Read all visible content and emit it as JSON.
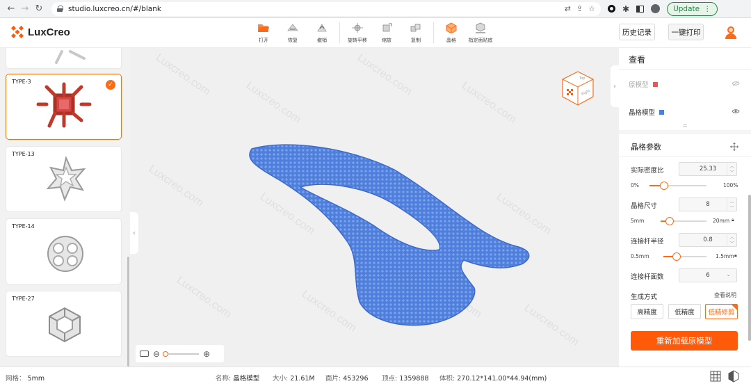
{
  "browser": {
    "url": "studio.luxcreo.cn/#/blank",
    "update_label": "Update"
  },
  "app": {
    "brand": "LuxCreo",
    "accent": "#ff6a14",
    "toolbar": [
      {
        "label": "打开",
        "icon": "open-folder-icon"
      },
      {
        "label": "恢复",
        "icon": "redo-icon"
      },
      {
        "label": "撤销",
        "icon": "undo-icon"
      },
      {
        "label": "旋转平移",
        "icon": "rotate-move-icon"
      },
      {
        "label": "缩放",
        "icon": "scale-icon"
      },
      {
        "label": "复制",
        "icon": "copy-icon"
      },
      {
        "label": "晶格",
        "icon": "lattice-icon"
      },
      {
        "label": "指定面贴底",
        "icon": "face-to-bottom-icon"
      }
    ],
    "history_label": "历史记录",
    "print_label": "一键打印"
  },
  "sidebar": {
    "items": [
      {
        "label": "TYPE-3",
        "selected": true
      },
      {
        "label": "TYPE-13",
        "selected": false
      },
      {
        "label": "TYPE-14",
        "selected": false
      },
      {
        "label": "TYPE-27",
        "selected": false
      }
    ]
  },
  "viewport": {
    "watermark": "Luxcreo.com",
    "cube_faces": [
      "Top",
      "Right"
    ],
    "model_color": "#4f7fdc"
  },
  "panel": {
    "view_title": "查看",
    "original_model": {
      "label": "原模型",
      "color": "#e05a5a"
    },
    "lattice_model": {
      "label": "晶格模型",
      "color": "#4f7fdc"
    },
    "params_title": "晶格参数",
    "density": {
      "label": "实际密度比",
      "value": "25.33",
      "min": "0%",
      "max": "100%",
      "fraction": 0.2533
    },
    "cell_size": {
      "label": "晶格尺寸",
      "value": "8",
      "min": "5mm",
      "max": "20mm",
      "fraction": 0.2
    },
    "rod_radius": {
      "label": "连接杆半径",
      "value": "0.8",
      "min": "0.5mm",
      "max": "1.5mm",
      "fraction": 0.3
    },
    "rod_faces": {
      "label": "连接杆面数",
      "value": "6"
    },
    "gen_mode_label": "生成方式",
    "help_link": "查看说明",
    "modes": [
      "高精度",
      "低精度",
      "低精修剪"
    ],
    "active_mode": "低精修剪",
    "reload_label": "重新加载原模型"
  },
  "status": {
    "grid_label": "网格：",
    "grid_value": "5mm",
    "name_label": "名称:",
    "name_value": "晶格模型",
    "size_label": "大小:",
    "size_value": "21.61M",
    "faces_label": "面片:",
    "faces_value": "453296",
    "vertices_label": "顶点:",
    "vertices_value": "1359888",
    "volume_label": "体积:",
    "volume_value": "270.12*141.00*44.94(mm)"
  }
}
